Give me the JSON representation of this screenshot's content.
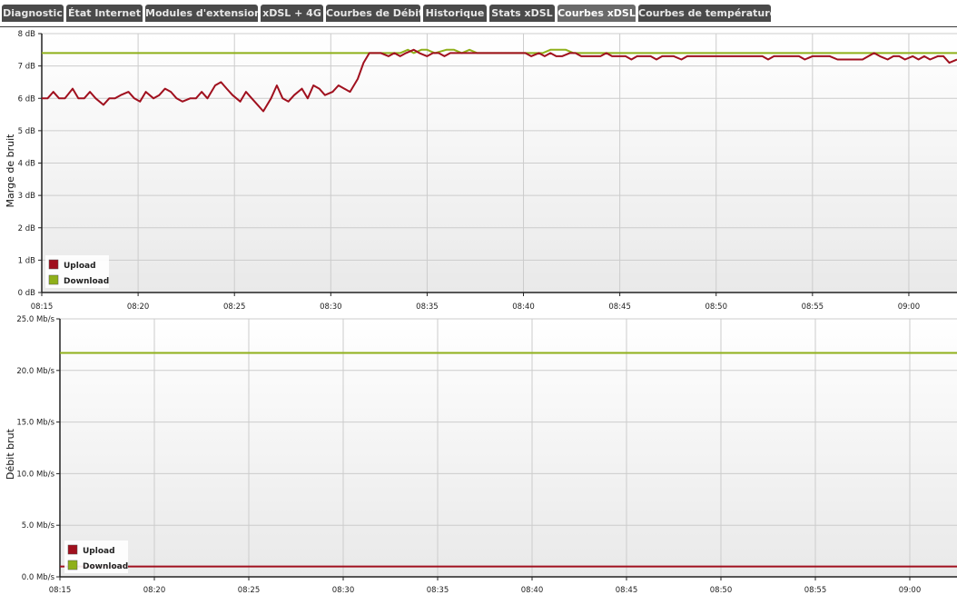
{
  "tabs": [
    {
      "label": "Diagnostic",
      "active": false
    },
    {
      "label": "État Internet",
      "active": false
    },
    {
      "label": "Modules d'extension",
      "active": false
    },
    {
      "label": "xDSL + 4G",
      "active": false
    },
    {
      "label": "Courbes de Débit",
      "active": false
    },
    {
      "label": "Historique",
      "active": false
    },
    {
      "label": "Stats xDSL",
      "active": false
    },
    {
      "label": "Courbes xDSL",
      "active": true
    },
    {
      "label": "Courbes de température",
      "active": false
    }
  ],
  "colors": {
    "upload": "#a0101e",
    "download": "#8fb01a",
    "grid": "#cccccc",
    "axis": "#222222",
    "tab_bg": "#4a4a4a",
    "tab_active_bg": "#6a6a6a"
  },
  "chart_data": [
    {
      "type": "line",
      "ylabel": "Marge de bruit",
      "ylim": [
        0,
        8
      ],
      "yticks": [
        "0 dB",
        "1 dB",
        "2 dB",
        "3 dB",
        "4 dB",
        "5 dB",
        "6 dB",
        "7 dB",
        "8 dB"
      ],
      "xticks": [
        "08:15",
        "08:20",
        "08:25",
        "08:30",
        "08:35",
        "08:40",
        "08:45",
        "08:50",
        "08:55",
        "09:00"
      ],
      "xrange_minutes": [
        0,
        47.5
      ],
      "legend_position": "bottom-left",
      "grid": true,
      "series": [
        {
          "name": "Upload",
          "color_key": "upload",
          "x": [
            0,
            0.3,
            0.6,
            0.9,
            1.2,
            1.6,
            1.9,
            2.2,
            2.5,
            2.8,
            3.2,
            3.5,
            3.8,
            4.1,
            4.5,
            4.8,
            5.1,
            5.4,
            5.8,
            6.1,
            6.4,
            6.7,
            7.0,
            7.3,
            7.7,
            8.0,
            8.3,
            8.6,
            9.0,
            9.3,
            9.6,
            9.9,
            10.3,
            10.6,
            10.9,
            11.2,
            11.5,
            11.9,
            12.2,
            12.5,
            12.8,
            13.1,
            13.5,
            13.8,
            14.1,
            14.4,
            14.7,
            15.1,
            15.4,
            15.7,
            16.0,
            16.4,
            16.7,
            17.0,
            17.3,
            17.6,
            18.0,
            18.3,
            18.6,
            18.9,
            19.3,
            19.6,
            20.0,
            20.3,
            20.6,
            20.9,
            21.2,
            21.6,
            21.9,
            22.2,
            22.5,
            22.9,
            23.2,
            23.5,
            23.8,
            24.1,
            24.5,
            24.8,
            25.1,
            25.4,
            25.8,
            26.1,
            26.4,
            26.7,
            27.0,
            27.4,
            27.7,
            28.0,
            28.3,
            28.7,
            29.0,
            29.3,
            29.6,
            29.9,
            30.3,
            30.6,
            30.9,
            31.2,
            31.6,
            31.9,
            32.2,
            32.5,
            32.8,
            33.2,
            33.5,
            33.8,
            34.1,
            34.4,
            34.8,
            35.1,
            35.4,
            35.7,
            36.1,
            36.4,
            36.7,
            37.0,
            37.4,
            37.7,
            38.0,
            38.3,
            38.7,
            39.0,
            39.3,
            39.6,
            40.0,
            40.3,
            40.6,
            40.9,
            41.3,
            41.6,
            41.9,
            42.2,
            42.6,
            42.9,
            43.2,
            43.5,
            43.9,
            44.2,
            44.5,
            44.8,
            45.2,
            45.5,
            45.8,
            46.1,
            46.5,
            46.8,
            47.1,
            47.5
          ],
          "values": [
            6.0,
            6.0,
            6.2,
            6.0,
            6.0,
            6.3,
            6.0,
            6.0,
            6.2,
            6.0,
            5.8,
            6.0,
            6.0,
            6.1,
            6.2,
            6.0,
            5.9,
            6.2,
            6.0,
            6.1,
            6.3,
            6.2,
            6.0,
            5.9,
            6.0,
            6.0,
            6.2,
            6.0,
            6.4,
            6.5,
            6.3,
            6.1,
            5.9,
            6.2,
            6.0,
            5.8,
            5.6,
            6.0,
            6.4,
            6.0,
            5.9,
            6.1,
            6.3,
            6.0,
            6.4,
            6.3,
            6.1,
            6.2,
            6.4,
            6.3,
            6.2,
            6.6,
            7.1,
            7.4,
            7.4,
            7.4,
            7.3,
            7.4,
            7.3,
            7.4,
            7.5,
            7.4,
            7.3,
            7.4,
            7.4,
            7.3,
            7.4,
            7.4,
            7.4,
            7.4,
            7.4,
            7.4,
            7.4,
            7.4,
            7.4,
            7.4,
            7.4,
            7.4,
            7.4,
            7.3,
            7.4,
            7.3,
            7.4,
            7.3,
            7.3,
            7.4,
            7.4,
            7.3,
            7.3,
            7.3,
            7.3,
            7.4,
            7.3,
            7.3,
            7.3,
            7.2,
            7.3,
            7.3,
            7.3,
            7.2,
            7.3,
            7.3,
            7.3,
            7.2,
            7.3,
            7.3,
            7.3,
            7.3,
            7.3,
            7.3,
            7.3,
            7.3,
            7.3,
            7.3,
            7.3,
            7.3,
            7.3,
            7.2,
            7.3,
            7.3,
            7.3,
            7.3,
            7.3,
            7.2,
            7.3,
            7.3,
            7.3,
            7.3,
            7.2,
            7.2,
            7.2,
            7.2,
            7.2,
            7.3,
            7.4,
            7.3,
            7.2,
            7.3,
            7.3,
            7.2,
            7.3,
            7.2,
            7.3,
            7.2,
            7.3,
            7.3,
            7.1,
            7.2
          ]
        },
        {
          "name": "Download",
          "color_key": "download",
          "x": [
            0,
            17.0,
            17.5,
            18.0,
            18.3,
            18.6,
            19.0,
            19.3,
            19.7,
            20.0,
            20.4,
            21.0,
            21.4,
            21.8,
            22.2,
            22.6,
            23.0,
            23.5,
            24.0,
            24.5,
            25.0,
            26.0,
            26.4,
            26.8,
            27.2,
            27.6,
            28.0,
            29.0,
            47.5
          ],
          "values": [
            7.4,
            7.4,
            7.4,
            7.4,
            7.4,
            7.4,
            7.5,
            7.4,
            7.5,
            7.5,
            7.4,
            7.5,
            7.5,
            7.4,
            7.5,
            7.4,
            7.4,
            7.4,
            7.4,
            7.4,
            7.4,
            7.4,
            7.5,
            7.5,
            7.5,
            7.4,
            7.4,
            7.4,
            7.4
          ]
        }
      ]
    },
    {
      "type": "line",
      "ylabel": "Débit brut",
      "ylim": [
        0,
        25
      ],
      "yticks": [
        "0.0 Mb/s",
        "5.0 Mb/s",
        "10.0 Mb/s",
        "15.0 Mb/s",
        "20.0 Mb/s",
        "25.0 Mb/s"
      ],
      "xticks": [
        "08:15",
        "08:20",
        "08:25",
        "08:30",
        "08:35",
        "08:40",
        "08:45",
        "08:50",
        "08:55",
        "09:00"
      ],
      "xrange_minutes": [
        0,
        47.5
      ],
      "legend_position": "bottom-left",
      "grid": true,
      "series": [
        {
          "name": "Upload",
          "color_key": "upload",
          "x": [
            0,
            47.5
          ],
          "values": [
            1.0,
            1.0
          ]
        },
        {
          "name": "Download",
          "color_key": "download",
          "x": [
            0,
            47.5
          ],
          "values": [
            21.7,
            21.7
          ]
        }
      ]
    }
  ]
}
